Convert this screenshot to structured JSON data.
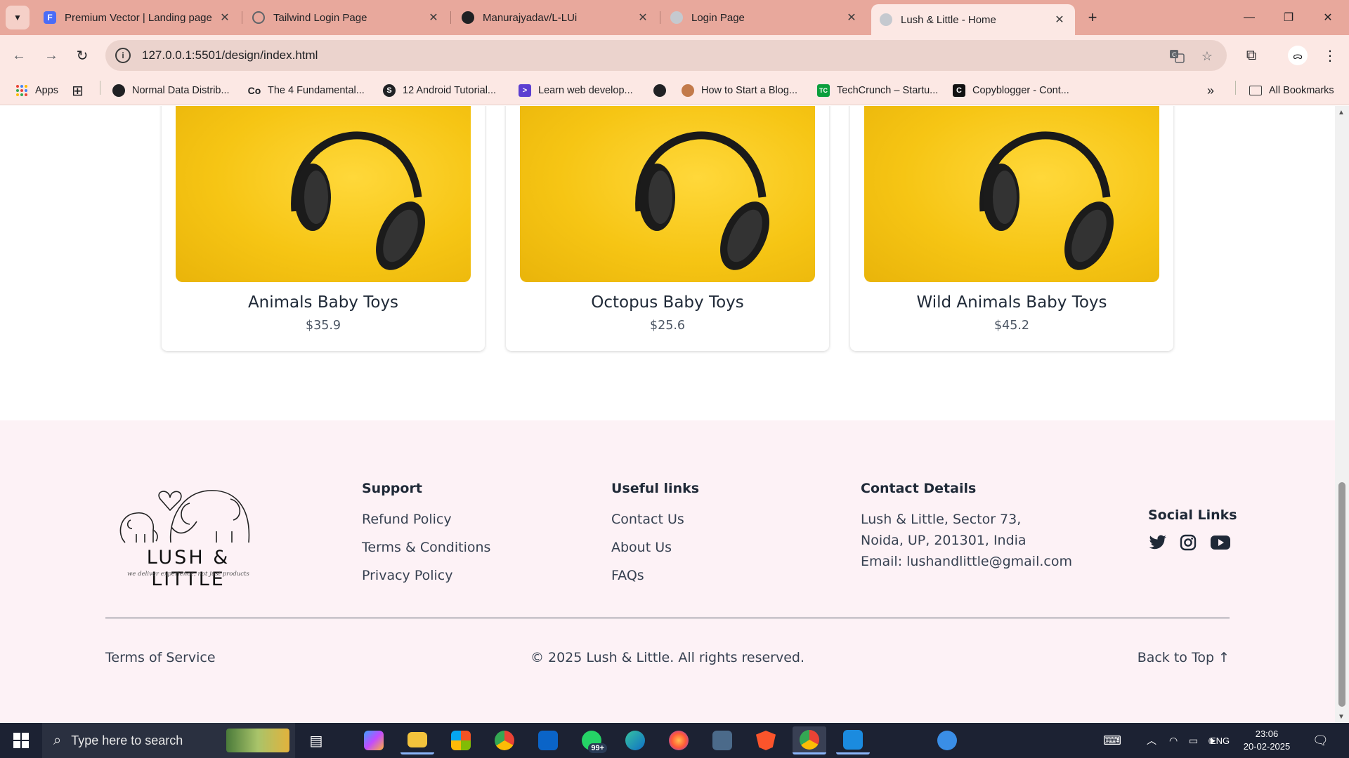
{
  "tabs": [
    {
      "title": "Premium Vector | Landing page",
      "favicon_color": "#4a6cf7"
    },
    {
      "title": "Tailwind Login Page",
      "favicon_color": "#5f6368"
    },
    {
      "title": "Manurajyadav/L-LUi",
      "favicon_color": "#202124"
    },
    {
      "title": "Login Page",
      "favicon_color": "#9aa0a6"
    },
    {
      "title": "Lush & Little - Home",
      "favicon_color": "#9aa0a6"
    }
  ],
  "address_bar": {
    "url": "127.0.0.1:5501/design/index.html"
  },
  "bookmarks": {
    "apps_label": "Apps",
    "items": [
      {
        "label": "Normal Data Distrib...",
        "icon_color": "#202124"
      },
      {
        "label": "The 4 Fundamental...",
        "icon_color": "#202124"
      },
      {
        "label": "12 Android Tutorial...",
        "icon_color": "#202124"
      },
      {
        "label": "Learn web develop...",
        "icon_color": "#5b3fd1"
      },
      {
        "label": "How to Start a Blog...",
        "icon_color": "#c27a4a"
      },
      {
        "label": "TechCrunch – Startu...",
        "icon_color": "#0a9e3c"
      },
      {
        "label": "Copyblogger - Cont...",
        "icon_color": "#111111"
      }
    ],
    "all_bookmarks_label": "All Bookmarks"
  },
  "products": [
    {
      "name": "Animals Baby Toys",
      "price": "$35.9"
    },
    {
      "name": "Octopus Baby Toys",
      "price": "$25.6"
    },
    {
      "name": "Wild Animals Baby Toys",
      "price": "$45.2"
    }
  ],
  "footer": {
    "logo_text": "LUSH & LITTLE",
    "logo_tagline": "we deliver experience, not just products",
    "support": {
      "heading": "Support",
      "links": [
        "Refund Policy",
        "Terms & Conditions",
        "Privacy Policy"
      ]
    },
    "useful_links": {
      "heading": "Useful links",
      "links": [
        "Contact Us",
        "About Us",
        "FAQs"
      ]
    },
    "contact": {
      "heading": "Contact Details",
      "lines": [
        "Lush & Little, Sector 73,",
        "Noida, UP, 201301, India",
        "Email: lushandlittle@gmail.com"
      ]
    },
    "social": {
      "heading": "Social Links",
      "icons": [
        "twitter-icon",
        "instagram-icon",
        "youtube-icon"
      ]
    },
    "terms_of_service": "Terms of Service",
    "copyright": "© 2025 Lush & Little. All rights reserved.",
    "back_to_top": "Back to Top ↑"
  },
  "taskbar": {
    "search_placeholder": "Type here to search",
    "whatsapp_badge": "99+",
    "language": "ENG",
    "time": "23:06",
    "date": "20-02-2025"
  },
  "colors": {
    "footer_bg": "#fdf2f6",
    "product_image_bg": "#f6c514",
    "tabstrip_bg": "#e8a89c"
  }
}
